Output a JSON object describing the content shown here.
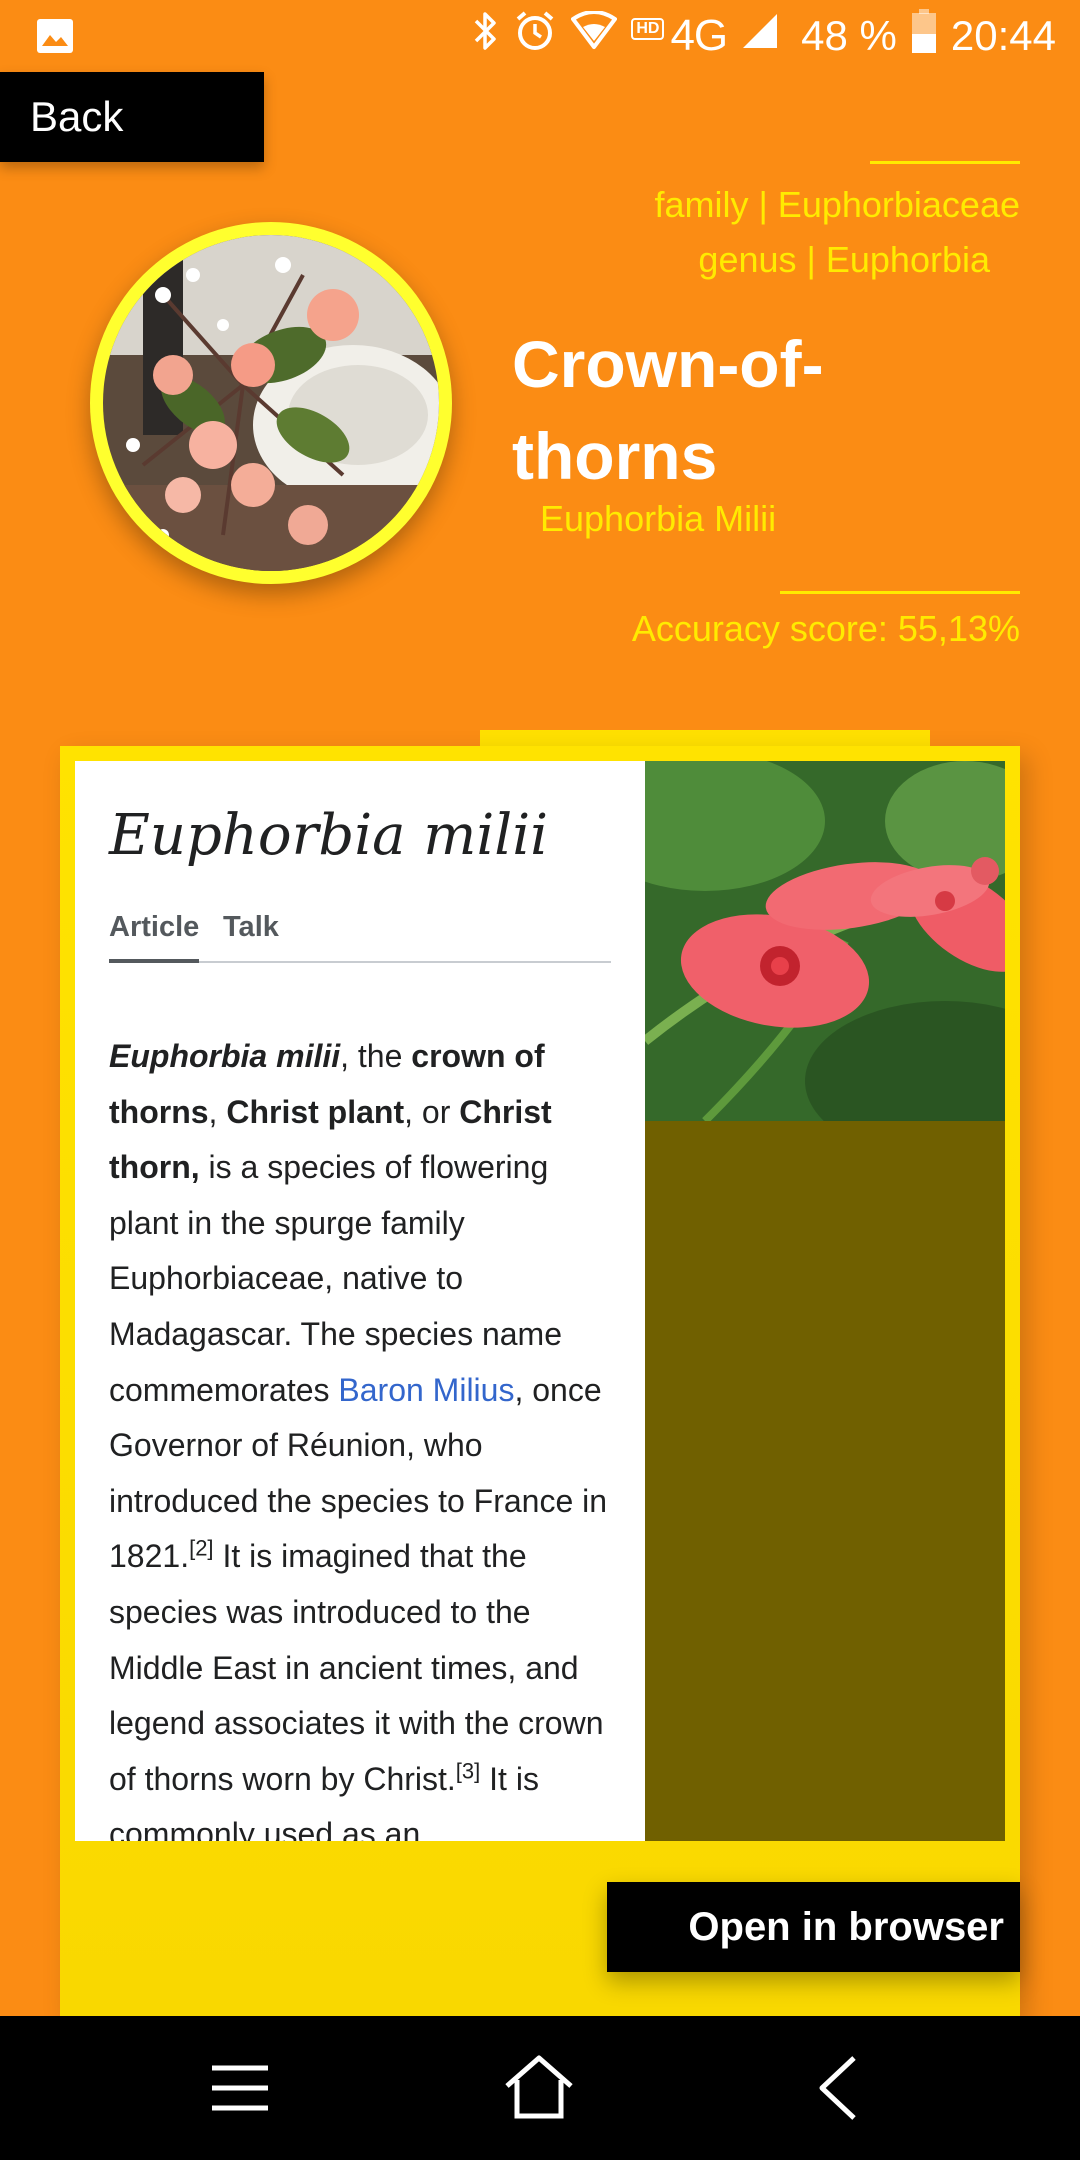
{
  "status_bar": {
    "gallery_icon": "image-icon",
    "bluetooth_icon": "bluetooth-icon",
    "alarm_icon": "alarm-clock-icon",
    "hd_label": "HD",
    "network_label": "4G",
    "battery_percent": "48 %",
    "time": "20:44"
  },
  "header": {
    "back_label": "Back",
    "family_line": "family | Euphorbiaceae",
    "genus_line": "genus | Euphorbia",
    "common_name": "Crown-of-thorns",
    "scientific_name": "Euphorbia Milii",
    "accuracy_line": "Accuracy score: 55,13%"
  },
  "wiki": {
    "title": "Euphorbia milii",
    "tabs": [
      "Article",
      "Talk"
    ],
    "active_tab": "Article",
    "paragraph": {
      "t1": "Euphorbia milii",
      "t2": ", the ",
      "t3": "crown of thorns",
      "t4": ", ",
      "t5": "Christ plant",
      "t6": ", or ",
      "t7": "Christ thorn,",
      "t8": " is a species of flowering plant in the spurge family Euphorbiaceae, native to Madagascar. The species name commemorates ",
      "link": "Baron Milius",
      "t9": ", once Governor of Réunion, who introduced the species to France in 1821.",
      "ref1": "[2]",
      "t10": " It is imagined that the species was introduced to the Middle East in ancient times, and legend associates it with the crown of thorns worn by Christ.",
      "ref2": "[3]",
      "t11": " It is commonly used as an"
    }
  },
  "actions": {
    "open_browser_label": "Open in browser"
  },
  "nav": {
    "menu_icon": "menu-icon",
    "home_icon": "home-icon",
    "back_icon": "back-arrow-icon"
  },
  "colors": {
    "background": "#FB8C14",
    "accent_yellow": "#FFEB00",
    "card_yellow": "#FFE300",
    "webview_olive": "#706000",
    "link_blue": "#3366cc"
  }
}
